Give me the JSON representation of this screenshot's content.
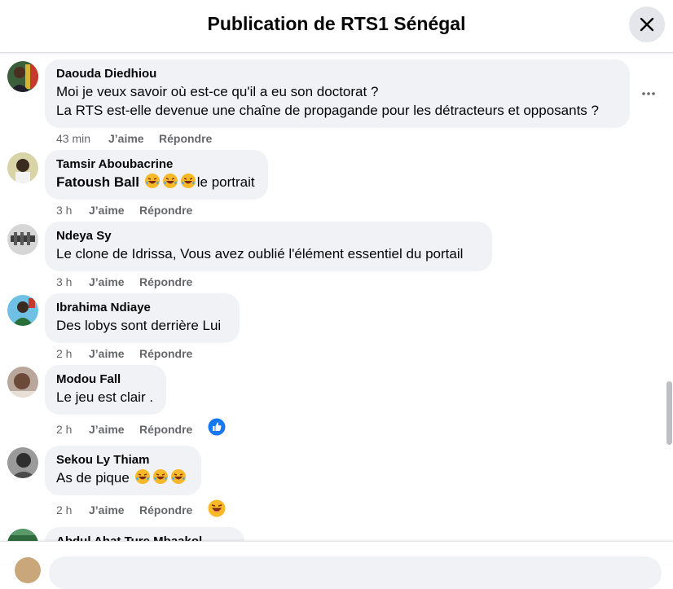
{
  "header": {
    "title": "Publication de RTS1 Sénégal"
  },
  "actions_labels": {
    "like": "J’aime",
    "reply": "Répondre"
  },
  "comments": [
    {
      "author": "Daouda Diedhiou",
      "lines": [
        "Moi je veux savoir où est-ce qu'il a eu son doctorat ?",
        "La RTS est-elle devenue une chaîne de propagande pour les détracteurs et opposants ?"
      ],
      "time": "43 min"
    },
    {
      "author": "Tamsir Aboubacrine",
      "mention": "Fatoush Ball",
      "text": "le portrait",
      "time": "3 h"
    },
    {
      "author": "Ndeya Sy",
      "text": "Le clone de Idrissa, Vous avez oublié l'élément essentiel du portail",
      "time": "3 h"
    },
    {
      "author": "Ibrahima Ndiaye",
      "text": "Des lobys sont derrière Lui",
      "time": "2 h"
    },
    {
      "author": "Modou Fall",
      "text": "Le jeu est clair .",
      "time": "2 h",
      "reaction": "like-reaction-icon"
    },
    {
      "author": "Sekou Ly Thiam",
      "text": "As de pique",
      "time": "2 h",
      "reaction": "haha-reaction-icon"
    },
    {
      "author": "Abdul Ahat Ture Mbaakol"
    }
  ],
  "colors": {
    "bubble": "#f0f2f5",
    "secondary_text": "#65676b",
    "like_blue": "#1877f2"
  }
}
